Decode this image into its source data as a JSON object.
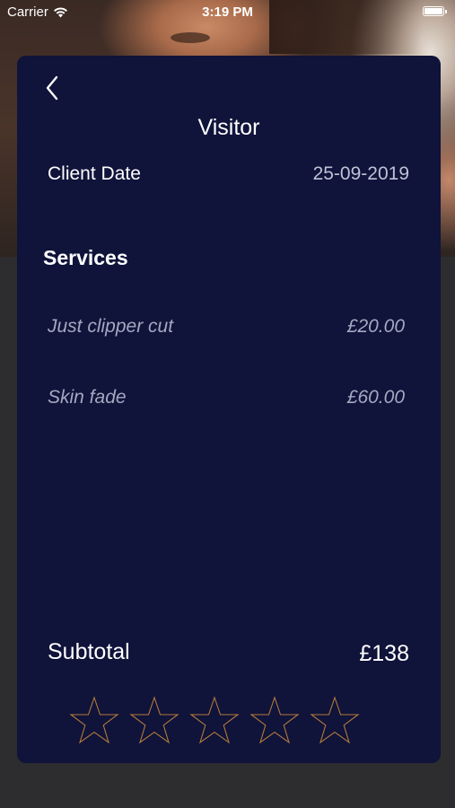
{
  "status_bar": {
    "carrier": "Carrier",
    "time": "3:19 PM",
    "battery_level": 1.0
  },
  "card": {
    "back_icon": "chevron-left-icon",
    "title": "Visitor",
    "client_date_label": "Client Date",
    "client_date_value": "25-09-2019",
    "services_heading": "Services",
    "services": [
      {
        "name": "Just clipper cut",
        "price": "£20.00"
      },
      {
        "name": "Skin fade",
        "price": "£60.00"
      }
    ],
    "subtotal_label": "Subtotal",
    "subtotal_value": "£138",
    "rating": {
      "value": 0,
      "max": 5,
      "star_color": "#b07a3a"
    }
  },
  "colors": {
    "card_background": "#10133a",
    "page_background": "#2d2d2f",
    "muted_text": "#a4a8c0"
  }
}
